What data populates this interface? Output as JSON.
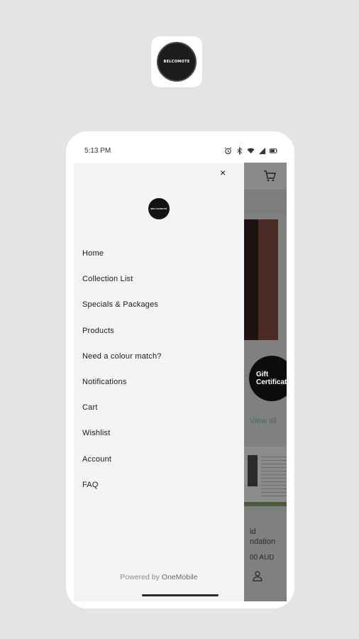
{
  "app_icon": {
    "logo_text": "BELCOMOTE",
    "icon": "brand-logo"
  },
  "status_bar": {
    "time": "5:13 PM",
    "icons": [
      "alarm-icon",
      "bluetooth-icon",
      "wifi-icon",
      "signal-icon",
      "battery-icon"
    ]
  },
  "drawer": {
    "close_label": "×",
    "logo_text": "BELCOMOTE",
    "menu": [
      {
        "label": "Home"
      },
      {
        "label": "Collection List"
      },
      {
        "label": "Specials & Packages"
      },
      {
        "label": "Products"
      },
      {
        "label": "Need a colour match?"
      },
      {
        "label": "Notifications"
      },
      {
        "label": "Cart"
      },
      {
        "label": "Wishlist"
      },
      {
        "label": "Account"
      },
      {
        "label": "FAQ"
      }
    ],
    "powered_by": "Powered by",
    "powered_brand": "OneMobile"
  },
  "background": {
    "gift_line1": "Gift",
    "gift_line2": "Certificat",
    "view_all": "View all",
    "product_line1": "id",
    "product_line2": "ndation",
    "product_price": "00 AUD"
  },
  "colors": {
    "page_bg": "#e4e4e4",
    "drawer_bg": "#f4f4f7",
    "overlay": "#808080",
    "accent": "#3f6a6a"
  }
}
